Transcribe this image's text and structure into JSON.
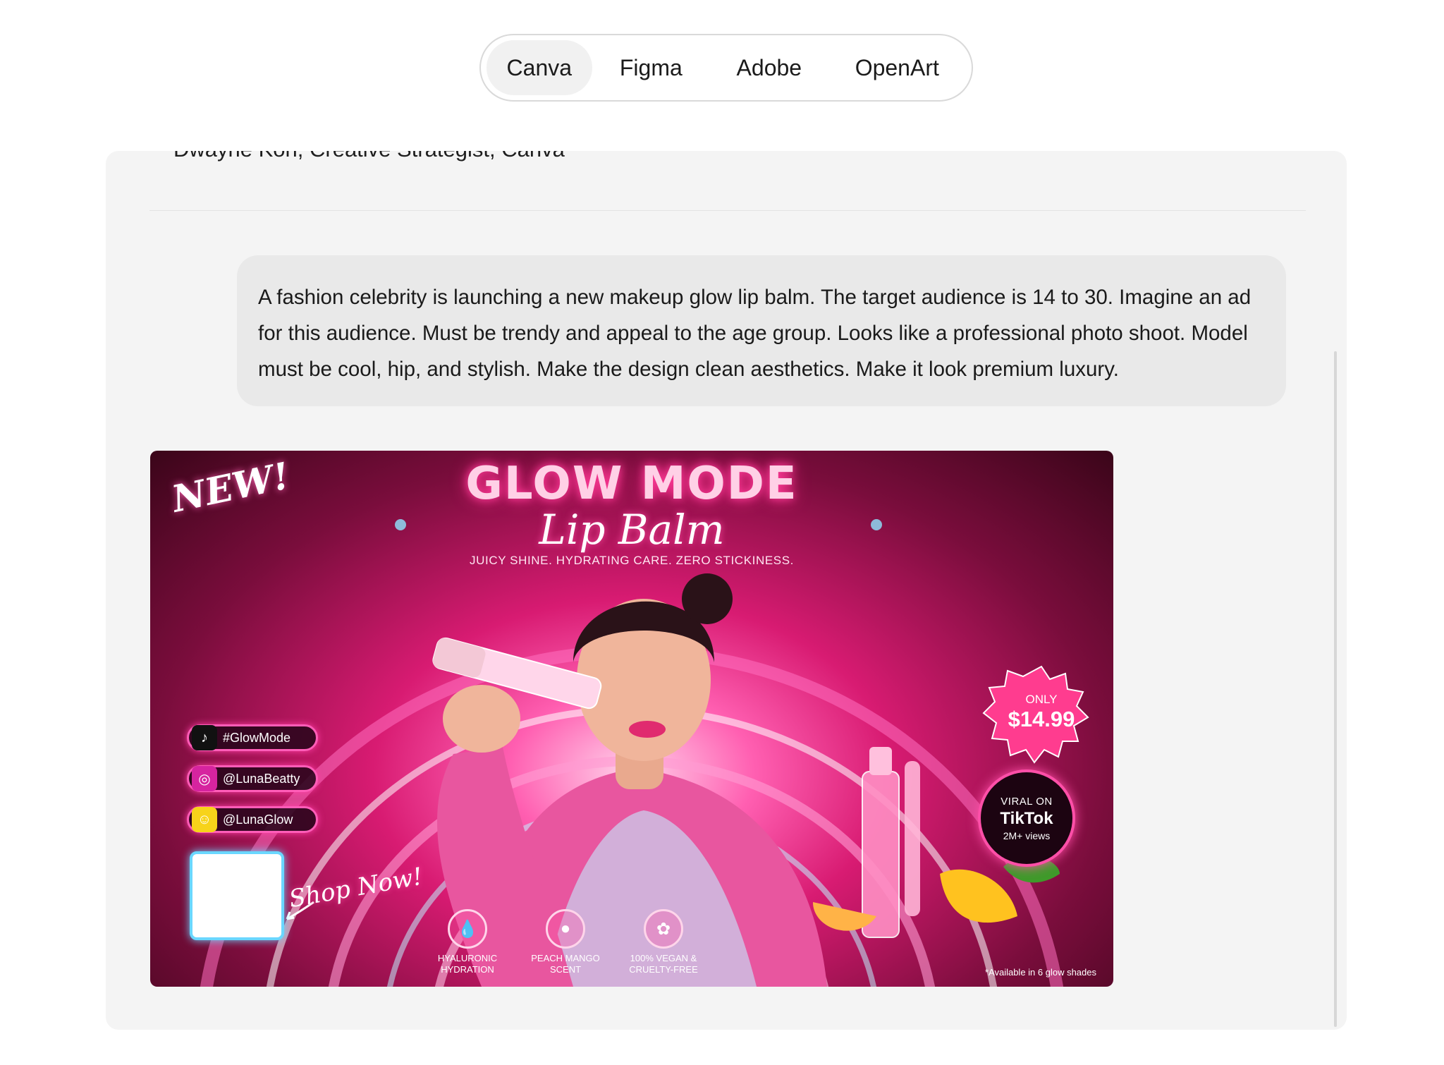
{
  "tabs": [
    {
      "label": "Canva",
      "active": true
    },
    {
      "label": "Figma",
      "active": false
    },
    {
      "label": "Adobe",
      "active": false
    },
    {
      "label": "OpenArt",
      "active": false
    }
  ],
  "attribution": "Dwayne Koh, Creative Strategist, Canva",
  "prompt": "A fashion celebrity is launching a new makeup glow lip balm. The target audience is 14 to 30. Imagine an ad for this audience. Must be trendy and appeal to the age group. Looks like a professional photo shoot. Model must be cool, hip, and stylish. Make the design clean aesthetics. Make it look premium luxury.",
  "ad": {
    "new_tag": "NEW!",
    "headline": "GLOW MODE",
    "script_line": "Lip Balm",
    "tagline": "JUICY SHINE. HYDRATING CARE. ZERO STICKINESS.",
    "socials": [
      {
        "icon": "tiktok-icon",
        "handle": "#GlowMode",
        "color": "#111111"
      },
      {
        "icon": "instagram-icon",
        "handle": "@LunaBeatty",
        "color": "#d6249f"
      },
      {
        "icon": "snapchat-icon",
        "handle": "@LunaGlow",
        "color": "#f7d31a"
      }
    ],
    "shop_now": "Shop Now!",
    "price_badge": {
      "only": "ONLY",
      "price": "$14.99"
    },
    "tiktok_badge": {
      "line1": "VIRAL ON",
      "line2": "TikTok",
      "line3": "2M+ views"
    },
    "features": [
      {
        "icon": "droplet-icon",
        "label": "HYALURONIC\nHYDRATION"
      },
      {
        "icon": "mango-icon",
        "label": "PEACH MANGO\nSCENT"
      },
      {
        "icon": "bunny-icon",
        "label": "100% VEGAN &\nCRUELTY-FREE"
      }
    ],
    "disclaimer": "*Available in 6 glow shades",
    "colors": {
      "neon_pink": "#ff4fa8",
      "deep_magenta": "#7a0d3c",
      "qr_glow": "#6ad7ff"
    }
  }
}
